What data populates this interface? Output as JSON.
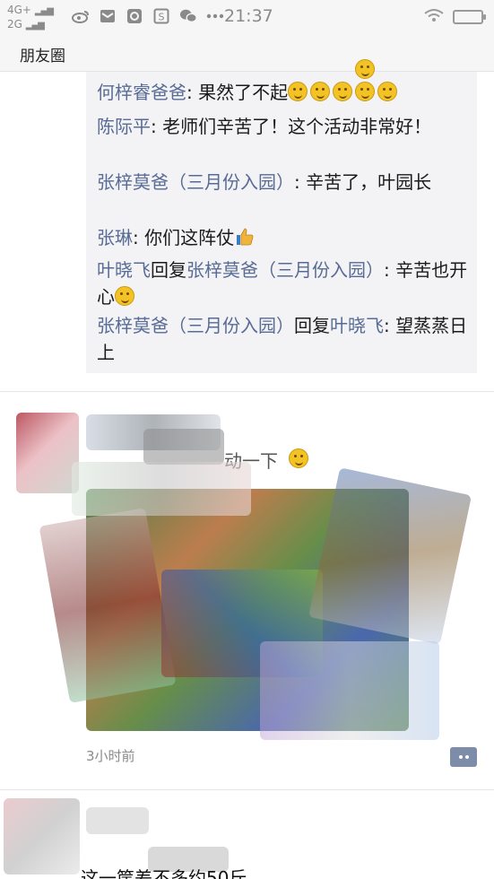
{
  "status_bar": {
    "network_top": "4G+",
    "network_bottom": "2G",
    "time": "21:37",
    "icons": [
      "weibo-icon",
      "mail-icon",
      "browser-icon",
      "s-app-icon",
      "wechat-icon",
      "more-dots-icon"
    ]
  },
  "header": {
    "title": "朋友圈"
  },
  "comments": [
    {
      "name": "何梓睿爸爸",
      "sep": ": ",
      "text": "果然了不起",
      "emoji_count": 5
    },
    {
      "name": "陈际平",
      "sep": ": ",
      "text": "老师们辛苦了！这个活动非常好！"
    },
    {
      "name": "张梓莫爸（三月份入园）",
      "sep": ": ",
      "text": "辛苦了，叶园长"
    },
    {
      "name": "张琳",
      "sep": ": ",
      "text": "你们这阵仗"
    },
    {
      "name": "叶晓飞",
      "reply_word": "回复",
      "reply_to": "张梓莫爸（三月份入园）",
      "sep": ": ",
      "text": "辛苦也开心"
    },
    {
      "name": "张梓莫爸（三月份入园）",
      "reply_word": "回复",
      "reply_to": "叶晓飞",
      "sep": ": ",
      "text": "望蒸蒸日上"
    }
  ],
  "post": {
    "text_fragment": "动一下",
    "time": "3小时前"
  },
  "next_post": {
    "text_fragment": "这一筐差不多约50斤"
  },
  "colors": {
    "name_link": "#576b95",
    "comment_bg": "#f3f3f5",
    "header_bg": "#f6f6f6"
  }
}
